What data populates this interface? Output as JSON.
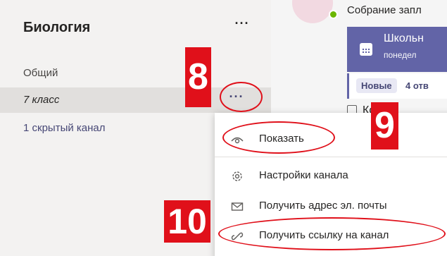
{
  "sidebar": {
    "team_name": "Биология",
    "team_more": "···",
    "channels": [
      {
        "label": "Общий"
      },
      {
        "label": "7 класс",
        "more": "···"
      },
      {
        "label": "1 скрытый канал"
      }
    ]
  },
  "feed": {
    "meeting_title": "Собрание запл",
    "card": {
      "title": "Школьн",
      "subtitle": "понедел"
    },
    "badge_new": "Новые",
    "replies_count": "4 отв",
    "end_text": "Конец"
  },
  "menu": {
    "items": [
      {
        "label": "Показать",
        "icon": "eye-icon"
      },
      {
        "label": "Настройки канала",
        "icon": "gear-icon"
      },
      {
        "label": "Получить адрес эл. почты",
        "icon": "envelope-icon"
      },
      {
        "label": "Получить ссылку на канал",
        "icon": "link-icon"
      }
    ]
  },
  "annotations": {
    "step_8": "8",
    "step_9": "9",
    "step_10": "10",
    "color": "#e0101a"
  },
  "colors": {
    "accent": "#6264a7",
    "sidebar_bg": "#f3f2f1",
    "selected_bg": "#e1dfdd",
    "status_green": "#6bb700"
  }
}
